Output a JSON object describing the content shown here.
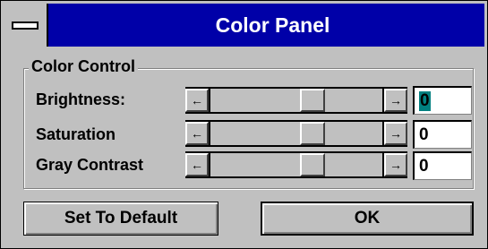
{
  "window": {
    "title": "Color Panel"
  },
  "group": {
    "label": "Color Control"
  },
  "rows": [
    {
      "label": "Brightness:",
      "value": "0"
    },
    {
      "label": "Saturation",
      "value": "0"
    },
    {
      "label": "Gray Contrast",
      "value": "0"
    }
  ],
  "icons": {
    "left_arrow": "←",
    "right_arrow": "→"
  },
  "buttons": {
    "default_label": "Set To Default",
    "ok_label": "OK"
  },
  "colors": {
    "titlebar": "#0000a8",
    "selection": "#008080"
  }
}
